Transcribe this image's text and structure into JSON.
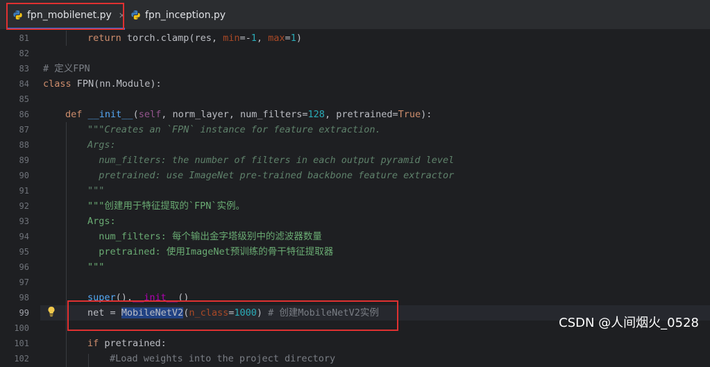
{
  "tabs": [
    {
      "label": "fpn_mobilenet.py",
      "close": "×"
    },
    {
      "label": "fpn_inception.py"
    }
  ],
  "line_numbers": [
    "81",
    "82",
    "83",
    "84",
    "85",
    "86",
    "87",
    "88",
    "89",
    "90",
    "91",
    "92",
    "93",
    "94",
    "95",
    "96",
    "97",
    "98",
    "99",
    "100",
    "101",
    "102"
  ],
  "current_line": "99",
  "code": {
    "l81": {
      "kw": "return",
      "rest": " torch.clamp(res, ",
      "p1": "min",
      "eq1": "=-",
      "n1": "1",
      "c": ", ",
      "p2": "max",
      "eq2": "=",
      "n2": "1",
      "end": ")"
    },
    "l83": "# 定义FPN",
    "l84": {
      "kw": "class",
      "rest": " FPN(nn.Module):"
    },
    "l86": {
      "kw": "def",
      "name": "__init__",
      "open": "(",
      "self": "self",
      "a": ", norm_layer, num_filters=",
      "n": "128",
      "b": ", pretrained=",
      "t": "True",
      "end": "):"
    },
    "l87": "\"\"\"Creates an `FPN` instance for feature extraction.",
    "l88": "Args:",
    "l89": "  num_filters: the number of filters in each output pyramid level",
    "l90": "  pretrained: use ImageNet pre-trained backbone feature extractor",
    "l91": "\"\"\"",
    "l92": "\"\"\"创建用于特征提取的`FPN`实例。",
    "l93": "Args:",
    "l94": "  num_filters: 每个输出金字塔级别中的滤波器数量",
    "l95": "  pretrained: 使用ImageNet预训练的骨干特征提取器",
    "l96": "\"\"\"",
    "l98": {
      "fn": "super",
      "mid": "().",
      "dunder": "__init__",
      "end": "()"
    },
    "l99": {
      "a": "net = ",
      "hl": "MobileNetV2",
      "open": "(",
      "p": "n_class",
      "eq": "=",
      "n": "1000",
      "close": ")",
      "cm": " # 创建MobileNetV2实例"
    },
    "l101": {
      "kw": "if",
      "rest": " pretrained:"
    },
    "l102": "#Load weights into the project directory"
  },
  "watermark": "CSDN @人间烟火_0528",
  "icons": {
    "tab_file": "python-icon",
    "gutter": "lightbulb-icon"
  },
  "colors": {
    "keyword": "#cf8e6d",
    "number": "#2aacb8",
    "docstring": "#5f826b",
    "highlight": "#214283",
    "annotation_box": "#e03131"
  }
}
